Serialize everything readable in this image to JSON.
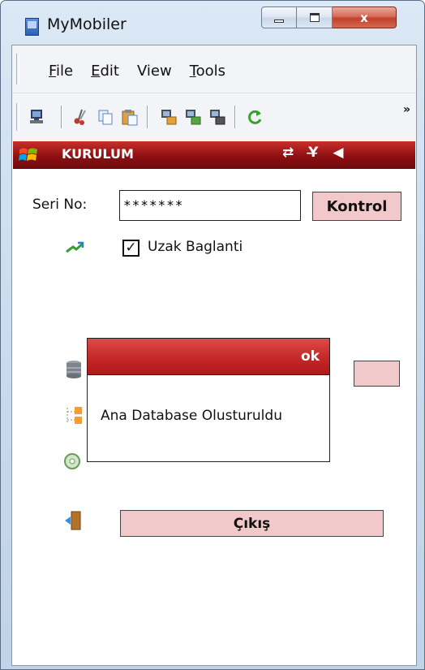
{
  "window": {
    "title": "MyMobiler",
    "controls": {
      "close": "x"
    }
  },
  "menu": {
    "items": [
      "File",
      "Edit",
      "View",
      "Tools"
    ]
  },
  "toolbar": {
    "icons": [
      "device-icon",
      "cut-icon",
      "copy-icon",
      "paste-icon",
      "transfer-icon-1",
      "transfer-icon-2",
      "transfer-icon-3",
      "refresh-icon"
    ],
    "overflow": "»"
  },
  "phone": {
    "header": {
      "title": "KURULUM",
      "status_icons": "⇄ Y̶ ◀"
    },
    "serial": {
      "label": "Seri No:",
      "value": "*******"
    },
    "kontrol_label": "Kontrol",
    "remote": {
      "label": "Uzak Baglanti",
      "checked": true,
      "check_glyph": "✓"
    },
    "exit_label": "Çıkış",
    "dialog": {
      "header": "ok",
      "message": "Ana Database Olusturuldu"
    }
  },
  "colors": {
    "header_red": "#8e0f12",
    "button_pink": "#f2c9ca",
    "dialog_red": "#c32525"
  }
}
